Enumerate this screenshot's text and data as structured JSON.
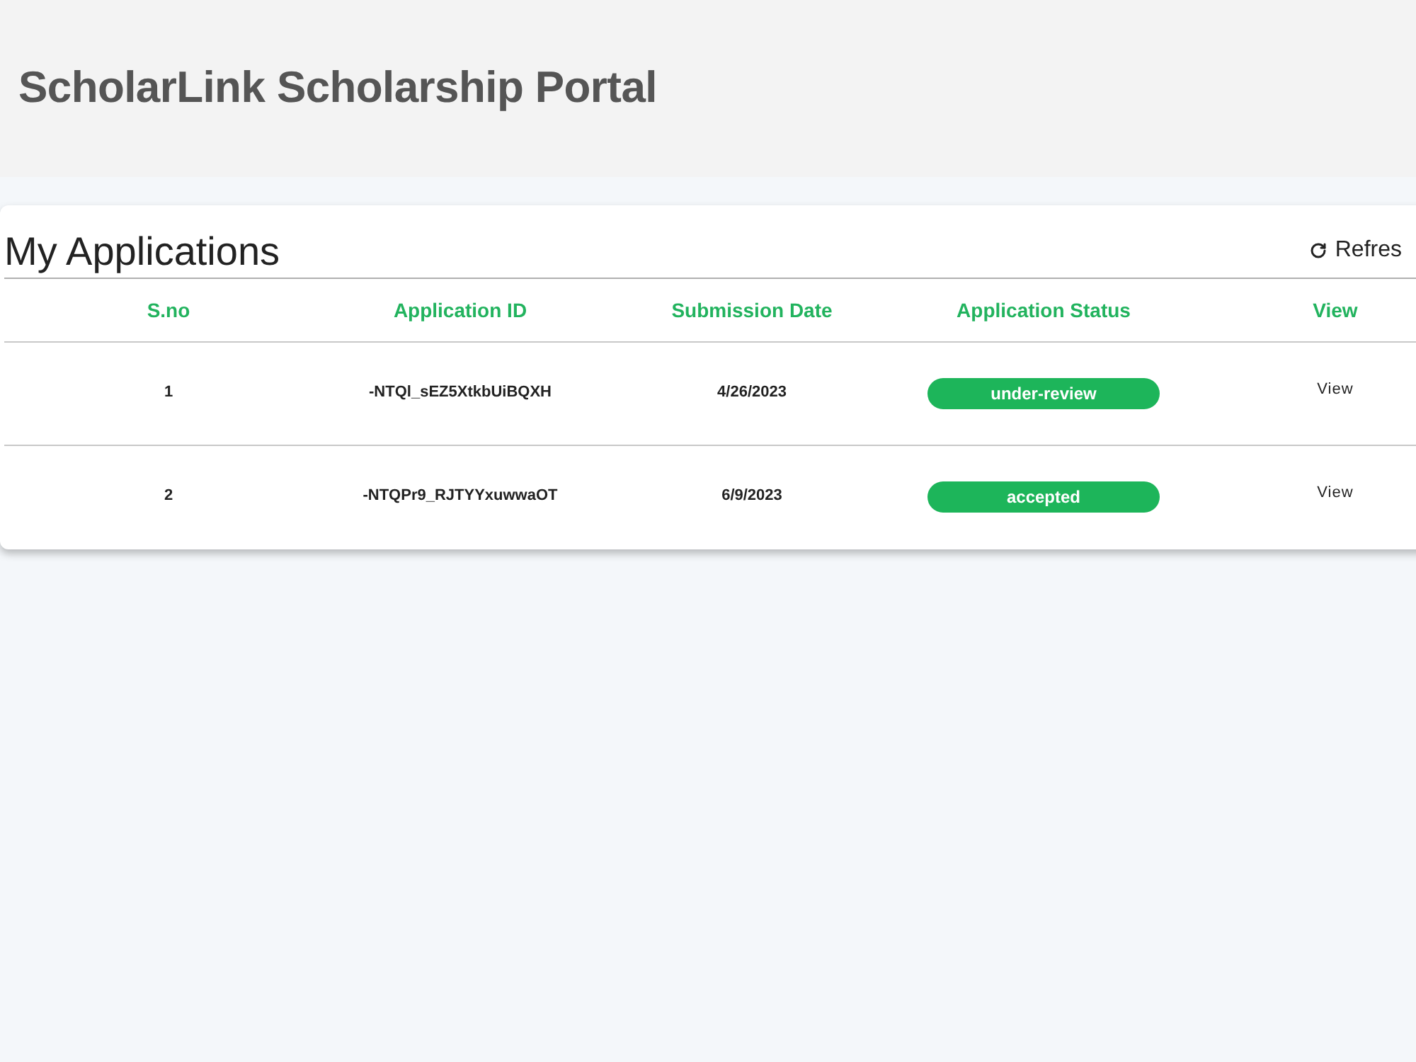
{
  "header": {
    "title": "ScholarLink Scholarship Portal"
  },
  "applications": {
    "title": "My Applications",
    "refresh_button": {
      "label": "Refres"
    },
    "table": {
      "columns": [
        "S.no",
        "Application ID",
        "Submission Date",
        "Application Status",
        "View"
      ],
      "rows": [
        {
          "sno": "1",
          "application_id": "-NTQl_sEZ5XtkbUiBQXH",
          "submission_date": "4/26/2023",
          "status": "under-review",
          "action": "View"
        },
        {
          "sno": "2",
          "application_id": "-NTQPr9_RJTYYxuwwaOT",
          "submission_date": "6/9/2023",
          "status": "accepted",
          "action": "View"
        }
      ]
    }
  }
}
